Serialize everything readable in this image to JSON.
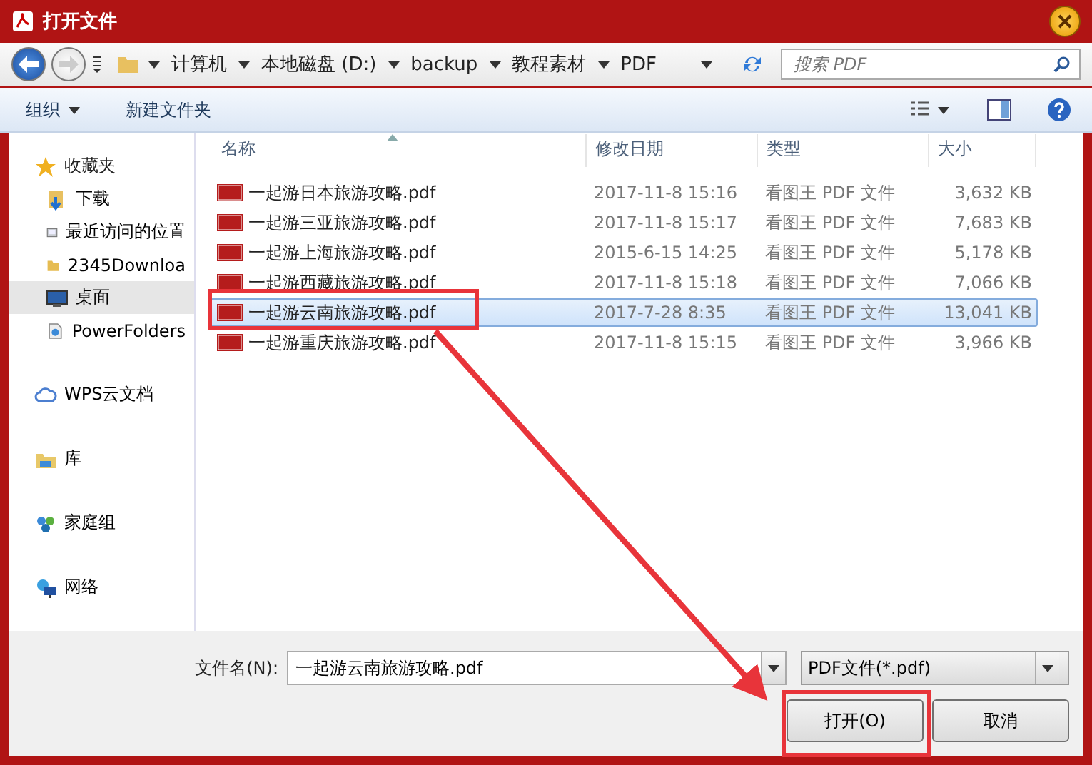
{
  "window": {
    "title": "打开文件"
  },
  "nav": {
    "breadcrumbs": [
      "计算机",
      "本地磁盘 (D:)",
      "backup",
      "教程素材",
      "PDF"
    ],
    "search": {
      "placeholder": "搜索 PDF"
    }
  },
  "toolbar": {
    "organize": "组织",
    "new_folder": "新建文件夹"
  },
  "sidebar": {
    "favorites": {
      "label": "收藏夹",
      "items": [
        {
          "label": "下载",
          "selected": false
        },
        {
          "label": "最近访问的位置",
          "selected": false
        },
        {
          "label": "2345Downloa",
          "selected": false
        },
        {
          "label": "桌面",
          "selected": true
        },
        {
          "label": "PowerFolders",
          "selected": false
        }
      ]
    },
    "groups": [
      {
        "label": "WPS云文档",
        "selected": false
      },
      {
        "label": "库",
        "selected": false
      },
      {
        "label": "家庭组",
        "selected": false
      },
      {
        "label": "网络",
        "selected": false
      }
    ]
  },
  "table": {
    "columns": [
      "名称",
      "修改日期",
      "类型",
      "大小"
    ],
    "rows": [
      {
        "name": "一起游日本旅游攻略.pdf",
        "date": "2017-11-8 15:16",
        "type": "看图王 PDF 文件",
        "size": "3,632 KB",
        "selected": false
      },
      {
        "name": "一起游三亚旅游攻略.pdf",
        "date": "2017-11-8 15:17",
        "type": "看图王 PDF 文件",
        "size": "7,683 KB",
        "selected": false
      },
      {
        "name": "一起游上海旅游攻略.pdf",
        "date": "2015-6-15 14:25",
        "type": "看图王 PDF 文件",
        "size": "5,178 KB",
        "selected": false
      },
      {
        "name": "一起游西藏旅游攻略.pdf",
        "date": "2017-11-8 15:18",
        "type": "看图王 PDF 文件",
        "size": "7,066 KB",
        "selected": false
      },
      {
        "name": "一起游云南旅游攻略.pdf",
        "date": "2017-7-28 8:35",
        "type": "看图王 PDF 文件",
        "size": "13,041 KB",
        "selected": true
      },
      {
        "name": "一起游重庆旅游攻略.pdf",
        "date": "2017-11-8 15:15",
        "type": "看图王 PDF 文件",
        "size": "3,966 KB",
        "selected": false
      }
    ]
  },
  "footer": {
    "filename_label": "文件名(N):",
    "filename": "一起游云南旅游攻略.pdf",
    "filetype": "PDF文件(*.pdf)",
    "buttons": [
      "打开(O)",
      "取消"
    ]
  }
}
